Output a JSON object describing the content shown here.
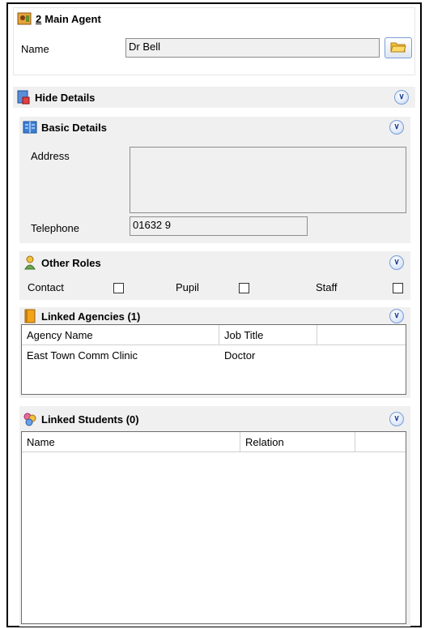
{
  "agent": {
    "number": "2",
    "title": "Main Agent",
    "name_label": "Name",
    "name_value": "Dr Bell",
    "browse_icon": "folder-open-icon"
  },
  "details": {
    "toggle_label": "Hide Details",
    "collapse_icon": "double-chevron-up-icon"
  },
  "basic_details": {
    "title": "Basic Details",
    "address_label": "Address",
    "address_value": "",
    "telephone_label": "Telephone",
    "telephone_value": "01632 9"
  },
  "other_roles": {
    "title": "Other Roles",
    "roles": [
      {
        "label": "Contact",
        "checked": false
      },
      {
        "label": "Pupil",
        "checked": false
      },
      {
        "label": "Staff",
        "checked": false
      }
    ]
  },
  "linked_agencies": {
    "title": "Linked Agencies (1)",
    "columns": [
      "Agency Name",
      "Job Title",
      ""
    ],
    "rows": [
      [
        "East Town Comm Clinic",
        "Doctor",
        ""
      ]
    ]
  },
  "linked_students": {
    "title": "Linked Students (0)",
    "columns": [
      "Name",
      "Relation",
      ""
    ],
    "rows": []
  },
  "colors": {
    "panel_bg": "#f0f0f0",
    "field_bg": "#f0f0f0",
    "button_accent": "#7a9fd6"
  }
}
